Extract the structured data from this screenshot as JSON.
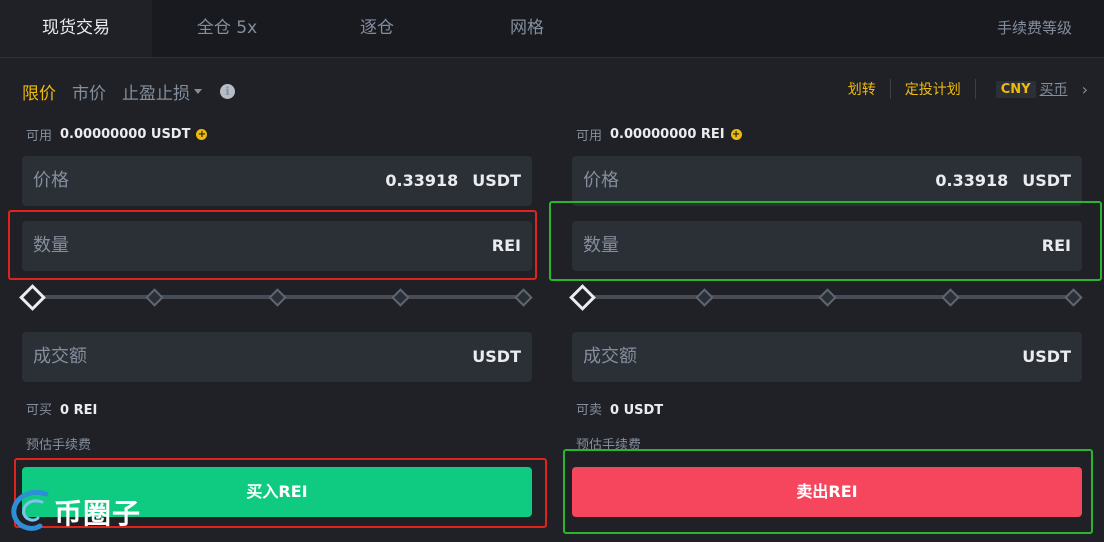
{
  "tabs": [
    {
      "label": "现货交易",
      "active": true
    },
    {
      "label": "全仓 5x",
      "active": false
    },
    {
      "label": "逐仓",
      "active": false
    },
    {
      "label": "网格",
      "active": false
    }
  ],
  "fee_level": "手续费等级",
  "order_types": {
    "limit": "限价",
    "market": "市价",
    "stop": "止盈止损"
  },
  "right_links": {
    "transfer": "划转",
    "auto_invest": "定投计划",
    "currency": "CNY",
    "buy_crypto": "买币"
  },
  "buy": {
    "available_label": "可用",
    "available_value": "0.00000000 USDT",
    "price_label": "价格",
    "price_value": "0.33918",
    "price_unit": "USDT",
    "amount_label": "数量",
    "amount_unit": "REI",
    "total_label": "成交额",
    "total_unit": "USDT",
    "max_label": "可买",
    "max_value": "0 REI",
    "fee_label": "预估手续费",
    "button_label": "买入REI"
  },
  "sell": {
    "available_label": "可用",
    "available_value": "0.00000000 REI",
    "price_label": "价格",
    "price_value": "0.33918",
    "price_unit": "USDT",
    "amount_label": "数量",
    "amount_unit": "REI",
    "total_label": "成交额",
    "total_unit": "USDT",
    "max_label": "可卖",
    "max_value": "0 USDT",
    "fee_label": "预估手续费",
    "button_label": "卖出REI"
  },
  "slider_level": 0,
  "watermark": "币圈子",
  "colors": {
    "accent": "#f0b90b",
    "buy": "#0ecb81",
    "sell": "#f6465d",
    "highlight_red": "#e0241c",
    "highlight_green": "#2bb52b"
  }
}
